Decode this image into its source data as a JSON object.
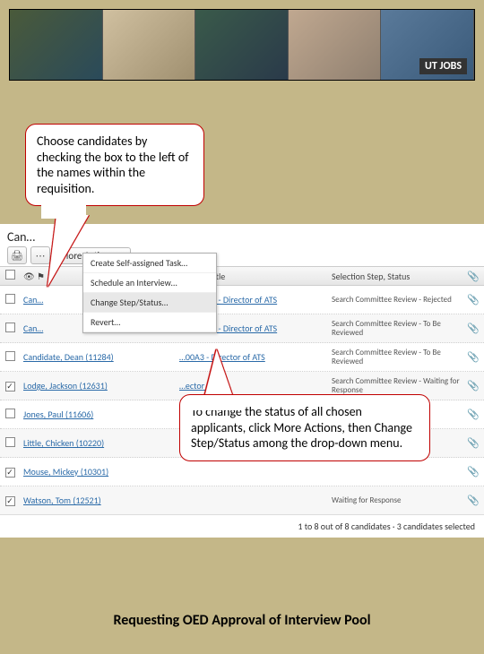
{
  "banner": {
    "logo_text": "UT JOBS"
  },
  "callouts": {
    "c1": "Choose candidates by checking the box to the left of the names within the requisition.",
    "c2": "To change the status of all chosen applicants, click More Actions, then Change Step/Status among the drop-down menu."
  },
  "app": {
    "title_fragment": "Can…",
    "more_actions_label": "More Actions",
    "menu": {
      "item1": "Create Self-assigned Task…",
      "item2": "Schedule an Interview…",
      "item3": "Change Step/Status…",
      "item4": "Revert…"
    },
    "headers": {
      "reqcol": "Req. ID, Title",
      "statuscol": "Selection Step, Status"
    },
    "rows": [
      {
        "checked": false,
        "name": "Can…",
        "req": "100000A3 - Director of ATS",
        "status": "Search Committee Review - Rejected"
      },
      {
        "checked": false,
        "name": "Can…",
        "req": "100000A3 - Director of ATS",
        "status": "Search Committee Review - To Be Reviewed"
      },
      {
        "checked": false,
        "name": "Candidate, Dean (11284)",
        "req": "…00A3 - Director of ATS",
        "status": "Search Committee Review - To Be Reviewed"
      },
      {
        "checked": true,
        "name": "Lodge, Jackson (12631)",
        "req": "…ector of ATS",
        "status": "Search Committee Review - Waiting for Response"
      },
      {
        "checked": false,
        "name": "Jones, Paul (11606)",
        "req": "",
        "status": ""
      },
      {
        "checked": false,
        "name": "Little, Chicken (10220)",
        "req": "",
        "status": ""
      },
      {
        "checked": true,
        "name": "Mouse, Mickey (10301)",
        "req": "",
        "status": ""
      },
      {
        "checked": true,
        "name": "Watson, Tom (12521)",
        "req": "",
        "status": "Waiting for Response"
      }
    ],
    "footer": "1 to 8 out of 8 candidates · 3 candidates selected"
  },
  "slide_footer": "Requesting OED Approval of Interview Pool"
}
